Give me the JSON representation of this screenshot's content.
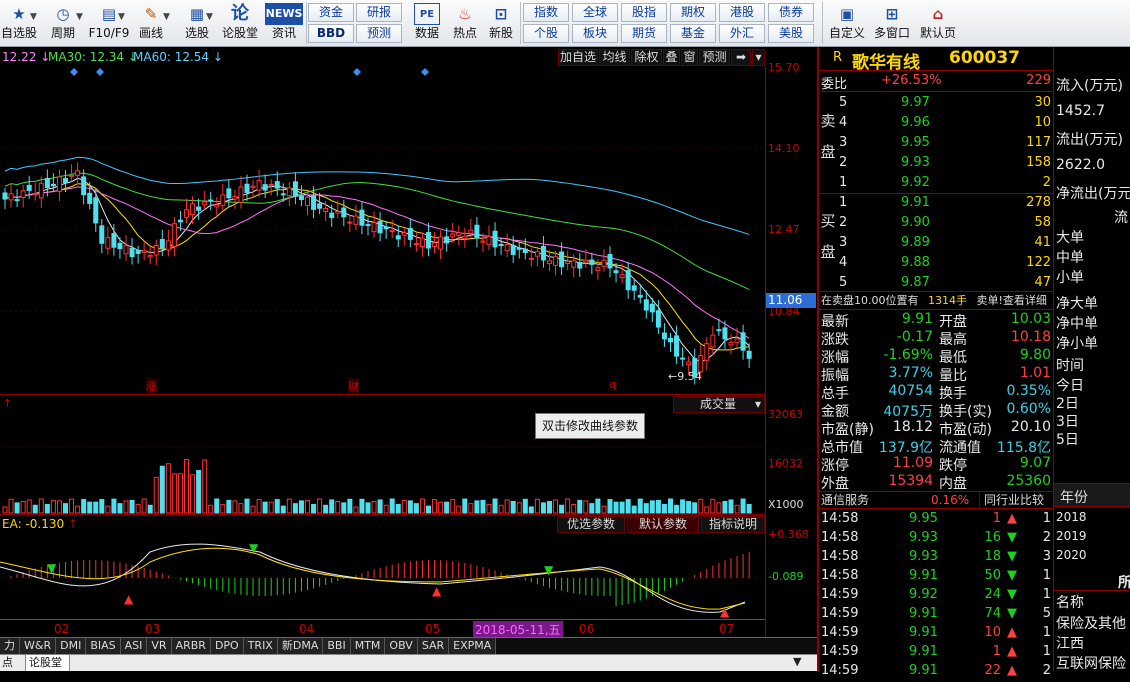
{
  "toolbar": {
    "items": [
      {
        "label": "自选股",
        "icon": "★"
      },
      {
        "label": "周期",
        "icon": "◷"
      },
      {
        "label": "F10/F9",
        "icon": "▤"
      },
      {
        "label": "画线",
        "icon": "✎"
      },
      {
        "label": "选股",
        "icon": "▦"
      },
      {
        "label": "论股堂",
        "icon": "论"
      },
      {
        "label": "资讯",
        "icon": "NEWS"
      }
    ],
    "grid1": [
      "资金",
      "研报",
      "BBD",
      "预测"
    ],
    "single1": [
      {
        "label": "数据",
        "icon": "PE"
      },
      {
        "label": "热点",
        "icon": "♨"
      },
      {
        "label": "新股",
        "icon": "⊡"
      }
    ],
    "grid2": [
      "指数",
      "全球",
      "股指",
      "期权",
      "港股",
      "债券",
      "个股",
      "板块",
      "期货",
      "基金",
      "外汇",
      "美股"
    ],
    "single2": [
      {
        "label": "自定义",
        "icon": "▣"
      },
      {
        "label": "多窗口",
        "icon": "⊞"
      },
      {
        "label": "默认页",
        "icon": "⌂"
      }
    ]
  },
  "chart_header": {
    "ma_partial": "12.22",
    "ma30": "MA30: 12.34",
    "ma60": "MA60: 12.54",
    "buttons": [
      "加自选",
      "均线",
      "除权",
      "叠",
      "窗",
      "预测",
      "➡"
    ]
  },
  "price_axis": [
    "15.70",
    "14.10",
    "12.47",
    "10.84"
  ],
  "last_price_tag": "11.06",
  "low_label": "9.54",
  "event_marks": [
    "涨",
    "财",
    "q"
  ],
  "volume_pane": {
    "title": "成交量",
    "axis": [
      "32063",
      "16032",
      "X1000"
    ],
    "tooltip": "双击修改曲线参数"
  },
  "macd_pane": {
    "legend": "EA: -0.130",
    "buttons": [
      "优选参数",
      "默认参数",
      "指标说明"
    ],
    "axis": [
      "+0.368",
      "-0.089"
    ]
  },
  "x_axis": {
    "labels": [
      "02",
      "03",
      "04",
      "05",
      "06",
      "07"
    ],
    "cursor_date": "2018-05-11,五"
  },
  "indicator_tabs": [
    "力",
    "W&R",
    "DMI",
    "BIAS",
    "ASI",
    "VR",
    "ARBR",
    "DPO",
    "TRIX",
    "新DMA",
    "BBI",
    "MTM",
    "OBV",
    "SAR",
    "EXPMA"
  ],
  "bottom_tabs": [
    "点",
    "论股堂"
  ],
  "quote": {
    "code_mark": "R",
    "name": "歌华有线",
    "code": "600037",
    "weibi_label": "委比",
    "weibi": "+26.53%",
    "weicha": "229",
    "sell_label": "卖盘",
    "buy_label": "买盘",
    "sells": [
      {
        "n": "5",
        "p": "9.97",
        "v": "30"
      },
      {
        "n": "4",
        "p": "9.96",
        "v": "10"
      },
      {
        "n": "3",
        "p": "9.95",
        "v": "117"
      },
      {
        "n": "2",
        "p": "9.93",
        "v": "158"
      },
      {
        "n": "1",
        "p": "9.92",
        "v": "2"
      }
    ],
    "buys": [
      {
        "n": "1",
        "p": "9.91",
        "v": "278"
      },
      {
        "n": "2",
        "p": "9.90",
        "v": "58"
      },
      {
        "n": "3",
        "p": "9.89",
        "v": "41"
      },
      {
        "n": "4",
        "p": "9.88",
        "v": "122"
      },
      {
        "n": "5",
        "p": "9.87",
        "v": "47"
      }
    ],
    "notice": "在卖盘10.00位置有",
    "notice_vol": "1314手",
    "notice_tail": "卖单!查看详细",
    "stats": [
      {
        "l1": "最新",
        "v1": "9.91",
        "c1": "grn",
        "l2": "开盘",
        "v2": "10.03",
        "c2": "grn"
      },
      {
        "l1": "涨跌",
        "v1": "-0.17",
        "c1": "grn",
        "l2": "最高",
        "v2": "10.18",
        "c2": "red"
      },
      {
        "l1": "涨幅",
        "v1": "-1.69%",
        "c1": "grn",
        "l2": "最低",
        "v2": "9.80",
        "c2": "grn"
      },
      {
        "l1": "振幅",
        "v1": "3.77%",
        "c1": "cy",
        "l2": "量比",
        "v2": "1.01",
        "c2": "red"
      },
      {
        "l1": "总手",
        "v1": "40754",
        "c1": "cy",
        "l2": "换手",
        "v2": "0.35%",
        "c2": "cy"
      },
      {
        "l1": "金额",
        "v1": "4075万",
        "c1": "cy",
        "l2": "换手(实)",
        "v2": "0.60%",
        "c2": "cy"
      },
      {
        "l1": "市盈(静)",
        "v1": "18.12",
        "c1": "wht",
        "l2": "市盈(动)",
        "v2": "20.10",
        "c2": "wht"
      },
      {
        "l1": "总市值",
        "v1": "137.9亿",
        "c1": "cy",
        "l2": "流通值",
        "v2": "115.8亿",
        "c2": "cy"
      },
      {
        "l1": "涨停",
        "v1": "11.09",
        "c1": "red",
        "l2": "跌停",
        "v2": "9.07",
        "c2": "grn"
      },
      {
        "l1": "外盘",
        "v1": "15394",
        "c1": "red",
        "l2": "内盘",
        "v2": "25360",
        "c2": "grn"
      }
    ],
    "industry_name": "通信服务",
    "industry_pct": "0.16%",
    "industry_btn": "同行业比较",
    "ticks": [
      {
        "t": "14:58",
        "p": "9.95",
        "v": "1",
        "d": "up",
        "n": "1"
      },
      {
        "t": "14:58",
        "p": "9.93",
        "v": "16",
        "d": "dn",
        "n": "2"
      },
      {
        "t": "14:58",
        "p": "9.93",
        "v": "18",
        "d": "dn",
        "n": "3"
      },
      {
        "t": "14:58",
        "p": "9.91",
        "v": "50",
        "d": "dn",
        "n": "1"
      },
      {
        "t": "14:59",
        "p": "9.92",
        "v": "24",
        "d": "dn",
        "n": "1"
      },
      {
        "t": "14:59",
        "p": "9.91",
        "v": "74",
        "d": "dn",
        "n": "5"
      },
      {
        "t": "14:59",
        "p": "9.91",
        "v": "10",
        "d": "up",
        "n": "1"
      },
      {
        "t": "14:59",
        "p": "9.91",
        "v": "1",
        "d": "up",
        "n": "1"
      },
      {
        "t": "14:59",
        "p": "9.91",
        "v": "22",
        "d": "up",
        "n": "2"
      }
    ]
  },
  "far_panel": {
    "rows": [
      {
        "t": "流入(万元)",
        "c": "wht"
      },
      {
        "t": "1452.7",
        "c": "red"
      },
      {
        "t": "流出(万元)",
        "c": "wht"
      },
      {
        "t": "2622.0",
        "c": "yel"
      },
      {
        "t": "净流出(万元)",
        "c": "wht"
      },
      {
        "t": "流",
        "c": "wht"
      },
      {
        "t": "大单",
        "c": "wht"
      },
      {
        "t": "中单",
        "c": "wht"
      },
      {
        "t": "小单",
        "c": "wht"
      },
      {
        "t": "净大单",
        "c": "wht"
      },
      {
        "t": "净中单",
        "c": "wht"
      },
      {
        "t": "净小单",
        "c": "wht"
      },
      {
        "t": "时间",
        "c": "wht"
      },
      {
        "t": "今日",
        "c": "wht"
      },
      {
        "t": "2日",
        "c": "wht"
      },
      {
        "t": "3日",
        "c": "wht"
      },
      {
        "t": "5日",
        "c": "wht"
      }
    ],
    "year_header": "年份",
    "years": [
      "2018",
      "2019",
      "2020"
    ],
    "sort_mark": "所",
    "name_header": "名称",
    "names": [
      "保险及其他",
      "江西",
      "互联网保险"
    ]
  }
}
